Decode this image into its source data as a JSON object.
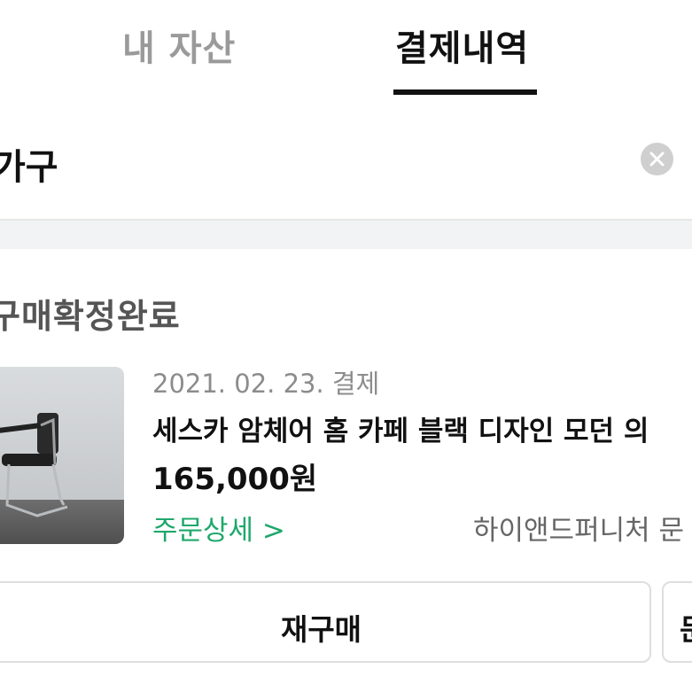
{
  "tabs": {
    "my_assets_label": "내 자산",
    "payment_history_label": "결제내역"
  },
  "search": {
    "query": "가구"
  },
  "order": {
    "status": "구매확정완료",
    "date": "2021. 02. 23. 결제",
    "title": "세스카 암체어 홈 카페 블랙 디자인 모던 의",
    "price": "165,000원",
    "detail_link": "주문상세 >",
    "seller": "하이앤드퍼니처 문"
  },
  "actions": {
    "rebuy_label": "재구매",
    "more_label": "문"
  },
  "icons": {
    "clear": "close-icon",
    "thumbnail": "chair-product-image"
  },
  "colors": {
    "accent_green": "#1ea86b",
    "tab_active": "#111111",
    "tab_inactive": "#9a9a9a"
  }
}
